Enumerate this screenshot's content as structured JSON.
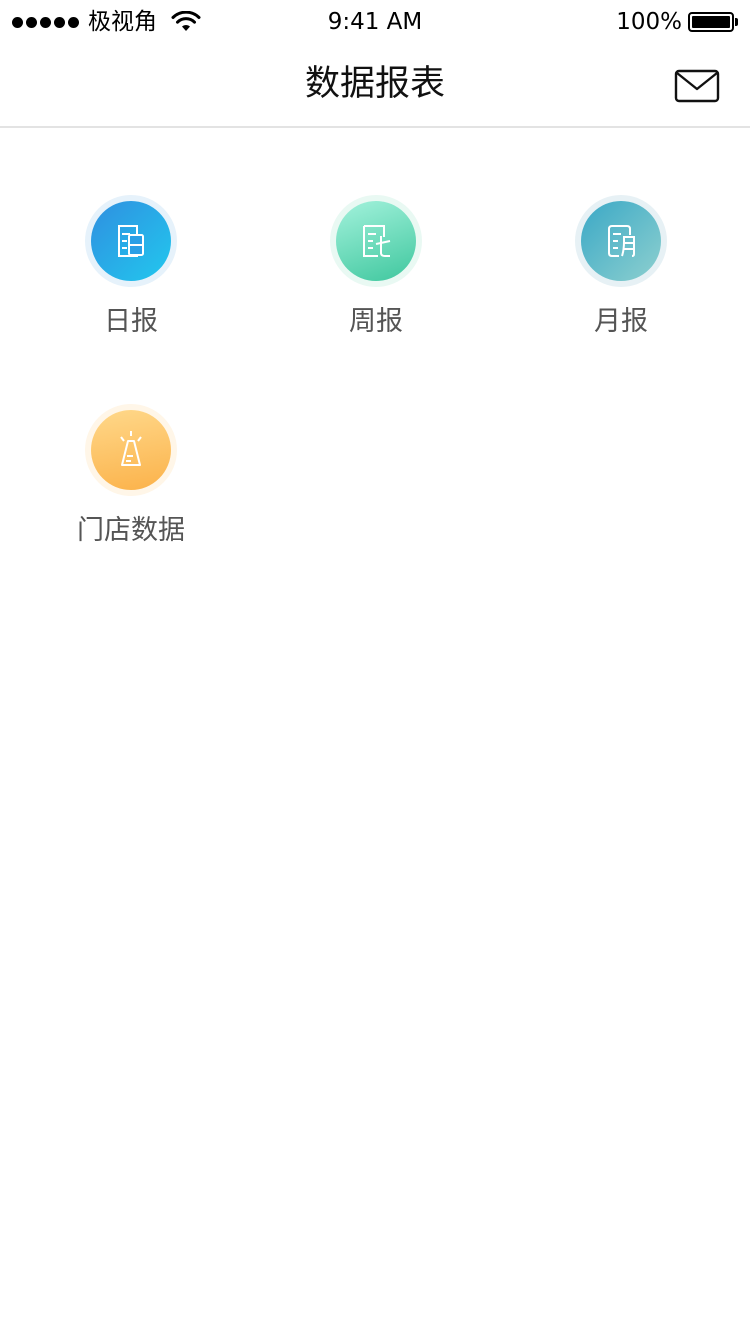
{
  "status_bar": {
    "carrier": "极视角",
    "time": "9:41 AM",
    "battery_percent": "100%"
  },
  "nav": {
    "title": "数据报表",
    "mail_icon": "mail-icon"
  },
  "reports": [
    {
      "label": "日报",
      "icon": "daily-report-icon",
      "color_from": "#2f8fe0",
      "color_to": "#22c8ee"
    },
    {
      "label": "周报",
      "icon": "weekly-report-icon",
      "color_from": "#a3f2dc",
      "color_to": "#3fc79e"
    },
    {
      "label": "月报",
      "icon": "monthly-report-icon",
      "color_from": "#3aa8c6",
      "color_to": "#8ed0cf"
    },
    {
      "label": "门店数据",
      "icon": "store-data-icon",
      "color_from": "#ffd88a",
      "color_to": "#fbb24a"
    }
  ]
}
